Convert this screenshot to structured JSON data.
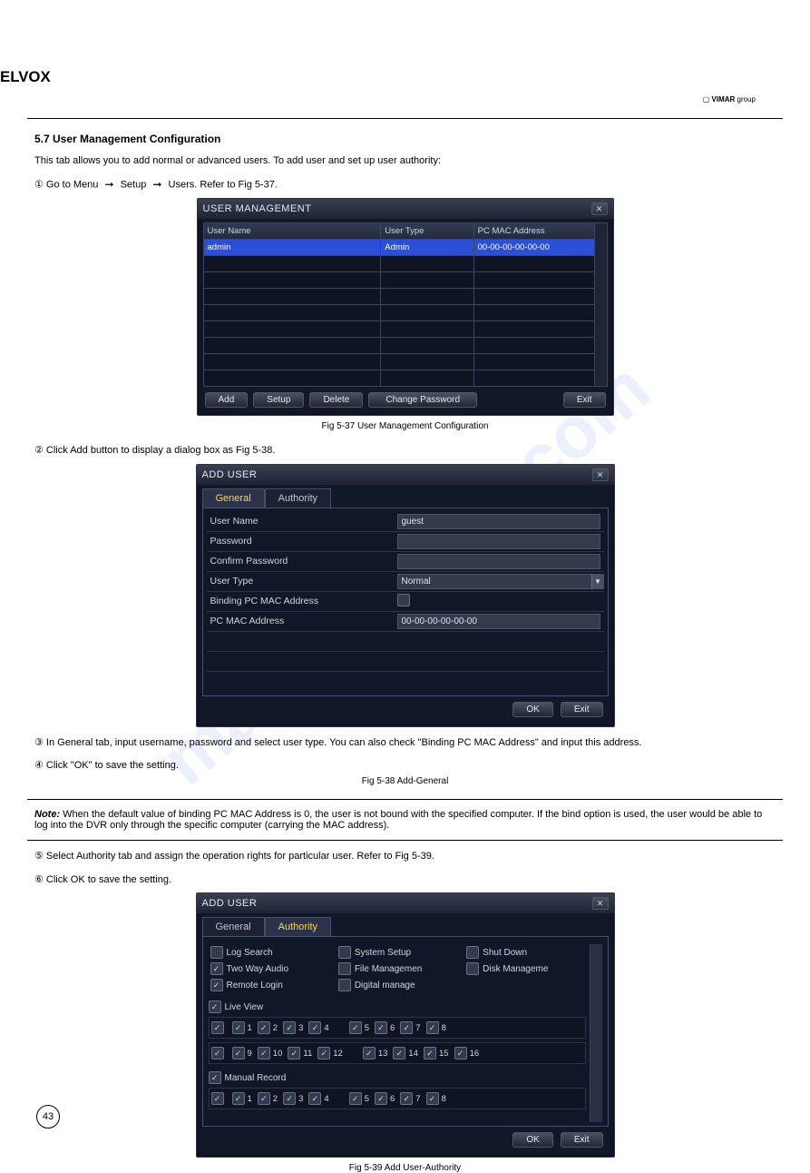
{
  "brand": {
    "logo_text": "ELVOX",
    "vimar": "VIMAR",
    "vimar_group": "group"
  },
  "section_heading": "5.7 User Management Configuration",
  "intro_text": "This tab allows you to add normal or advanced users. To add user and set up user authority:",
  "step1_pre": "① Go to Menu",
  "step1_setup": "Setup",
  "step1_users": "Users. Refer to Fig 5-37.",
  "fig37_caption": "Fig 5-37 User Management Configuration",
  "fig38_caption": "Fig 5-38 Add-General",
  "fig39_caption": "Fig 5-39 Add User-Authority",
  "step2": "② Click Add button to display a dialog box as Fig 5-38.",
  "step3": "③ In General tab, input username, password and select user type. You can also check \"Binding PC MAC Address\" and input this address.",
  "step4": "④ Click \"OK\" to save the setting.",
  "note_title": "Note:",
  "note_body": "When the default value of binding PC MAC Address is 0, the user is not bound with the specified computer. If the bind option is used, the user would be able to log into the DVR only through the specific computer (carrying the MAC address).",
  "step5": "⑤ Select Authority tab and assign the operation rights for particular user. Refer to Fig 5-39.",
  "step6": "⑥ Click OK to save the setting.",
  "user_mgmt": {
    "title": "USER MANAGEMENT",
    "headers": [
      "User Name",
      "User Type",
      "PC MAC Address"
    ],
    "row": {
      "name": "admin",
      "type": "Admin",
      "mac": "00-00-00-00-00-00"
    },
    "buttons": {
      "add": "Add",
      "setup": "Setup",
      "delete": "Delete",
      "change_pw": "Change Password",
      "exit": "Exit"
    }
  },
  "add_user": {
    "title": "ADD USER",
    "tabs": {
      "general": "General",
      "authority": "Authority"
    },
    "labels": {
      "user_name": "User Name",
      "password": "Password",
      "confirm_password": "Confirm Password",
      "user_type": "User Type",
      "bind_mac": "Binding PC MAC Address",
      "pc_mac": "PC MAC Address"
    },
    "values": {
      "user_name": "guest",
      "password": "",
      "confirm_password": "",
      "user_type": "Normal",
      "pc_mac": "00-00-00-00-00-00"
    },
    "buttons": {
      "ok": "OK",
      "exit": "Exit"
    }
  },
  "authority": {
    "col1": [
      "Log Search",
      "Two Way Audio",
      "Remote Login"
    ],
    "col2": [
      "System Setup",
      "File Managemen",
      "Digital manage"
    ],
    "col3": [
      "Shut Down",
      "Disk Manageme"
    ],
    "live_view_label": "Live View",
    "manual_record_label": "Manual Record",
    "nums_live_r1": [
      "",
      "1",
      "2",
      "3",
      "4",
      "",
      "5",
      "6",
      "7",
      "8"
    ],
    "nums_live_r2": [
      "",
      "9",
      "10",
      "11",
      "12",
      "",
      "13",
      "14",
      "15",
      "16"
    ],
    "nums_manual": [
      "",
      "1",
      "2",
      "3",
      "4",
      "",
      "5",
      "6",
      "7",
      "8"
    ]
  },
  "page_number": "43"
}
